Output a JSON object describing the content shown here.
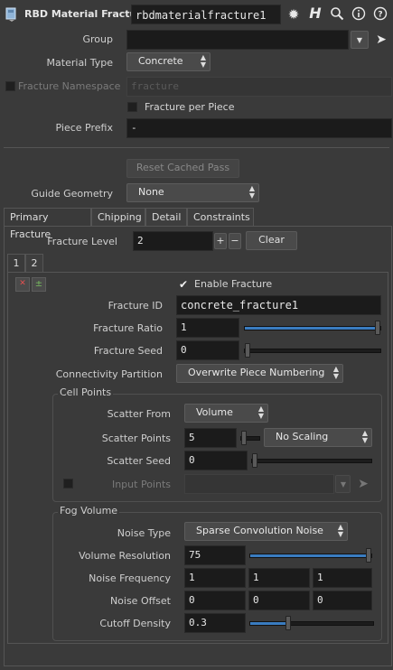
{
  "header": {
    "node_type": "RBD Material Fracture",
    "node_name": "rbdmaterialfracture1"
  },
  "params": {
    "group_label": "Group",
    "group_value": "",
    "material_type_label": "Material Type",
    "material_type_value": "Concrete",
    "fracture_namespace_label": "Fracture Namespace",
    "fracture_namespace_value": "fracture",
    "fracture_per_piece_label": "Fracture per Piece",
    "piece_prefix_label": "Piece Prefix",
    "piece_prefix_value": "-",
    "reset_cached_pass_label": "Reset Cached Pass",
    "guide_geometry_label": "Guide Geometry",
    "guide_geometry_value": "None"
  },
  "tabs": [
    "Primary Fracture",
    "Chipping",
    "Detail",
    "Constraints"
  ],
  "fracture_level": {
    "label": "Fracture Level",
    "value": "2",
    "plus": "+",
    "minus": "−",
    "clear_label": "Clear"
  },
  "level_tabs": [
    "1",
    "2"
  ],
  "level": {
    "enable_fracture_label": "Enable Fracture",
    "fracture_id_label": "Fracture ID",
    "fracture_id_value": "concrete_fracture1",
    "fracture_ratio_label": "Fracture Ratio",
    "fracture_ratio_value": "1",
    "fracture_ratio_fraction": 1.0,
    "fracture_seed_label": "Fracture Seed",
    "fracture_seed_value": "0",
    "fracture_seed_fraction": 0.0,
    "connectivity_label": "Connectivity Partition",
    "connectivity_value": "Overwrite Piece Numbering"
  },
  "cell_points": {
    "title": "Cell Points",
    "scatter_from_label": "Scatter From",
    "scatter_from_value": "Volume",
    "scatter_points_label": "Scatter Points",
    "scatter_points_value": "5",
    "scatter_points_fraction": 0.0,
    "scaling_value": "No Scaling",
    "scatter_seed_label": "Scatter Seed",
    "scatter_seed_value": "0",
    "scatter_seed_fraction": 0.0,
    "input_points_label": "Input Points",
    "input_points_value": ""
  },
  "fog_volume": {
    "title": "Fog Volume",
    "noise_type_label": "Noise Type",
    "noise_type_value": "Sparse Convolution Noise",
    "volume_resolution_label": "Volume Resolution",
    "volume_resolution_value": "75",
    "volume_resolution_fraction": 1.0,
    "noise_frequency_label": "Noise Frequency",
    "noise_frequency_values": [
      "1",
      "1",
      "1"
    ],
    "noise_offset_label": "Noise Offset",
    "noise_offset_values": [
      "0",
      "0",
      "0"
    ],
    "cutoff_density_label": "Cutoff Density",
    "cutoff_density_value": "0.3",
    "cutoff_density_fraction": 0.3
  },
  "colors": {
    "accent": "#3a7cc0",
    "panel": "#3a3a3a",
    "field": "#1b1b1b"
  }
}
